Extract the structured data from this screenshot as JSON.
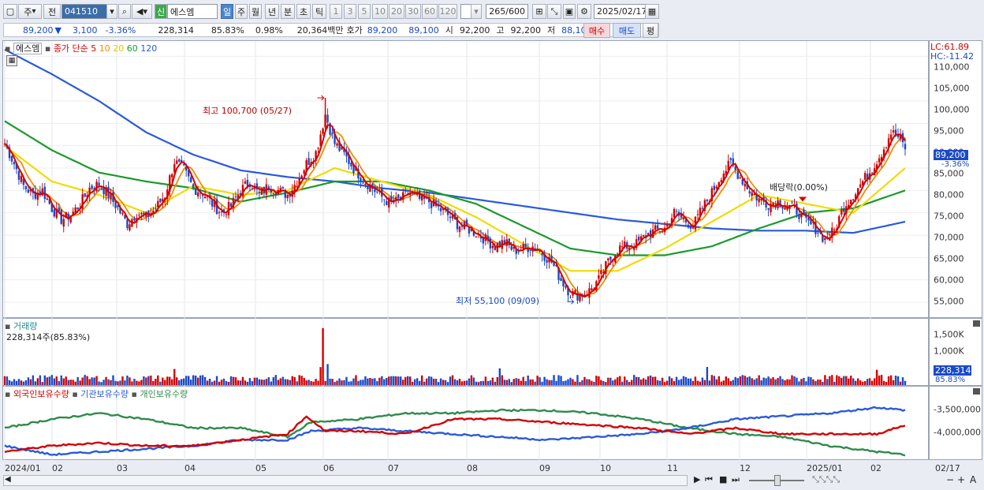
{
  "toolbar": {
    "type_label": "주",
    "prev_label": "전",
    "code": "041510",
    "badge": "신",
    "name": "에스엠",
    "periods": [
      "일",
      "주",
      "월",
      "년",
      "분",
      "초",
      "틱"
    ],
    "active_period": "일",
    "intervals": [
      "1",
      "3",
      "5",
      "10",
      "20",
      "30",
      "60",
      "120"
    ],
    "count": "265",
    "count_total": "/600",
    "date": "2025/02/17"
  },
  "quote": {
    "price": "89,200",
    "direction": "▼",
    "change": "3,100",
    "change_pct": "-3.36%",
    "volume": "228,314",
    "volume_ratio": "85.83%",
    "turnover_pct": "0.98%",
    "amount": "20,364백만",
    "bid_label": "호가",
    "ask": "89,200",
    "bid": "89,100",
    "open_label": "시",
    "open": "92,200",
    "high_label": "고",
    "high": "92,200",
    "low_label": "저",
    "low": "88,100",
    "buy_label": "매수",
    "sell_label": "매도",
    "avg_label": "평"
  },
  "price_panel": {
    "name": "에스엠",
    "ma_label": "종가 단순",
    "ma_periods": [
      "5",
      "10",
      "20",
      "60",
      "120"
    ],
    "ma_colors": [
      "#d40000",
      "#f08c00",
      "#f0dc00",
      "#1a9a2a",
      "#2a5ad8"
    ],
    "lc": "LC:61.89",
    "hc": "HC:-11.42",
    "high_annotation": "최고 100,700 (05/27)",
    "low_annotation": "최저 55,100 (09/09)",
    "dividend_annotation": "배당락(0.00%)",
    "current_price": "89,200",
    "current_pct": "-3.36%",
    "y_ticks": [
      "110,000",
      "105,000",
      "100,000",
      "95,000",
      "90,000",
      "85,000",
      "80,000",
      "75,000",
      "70,000",
      "65,000",
      "60,000",
      "55,000"
    ]
  },
  "volume_panel": {
    "title": "거래량",
    "info": "228,314주(85.83%)",
    "y_ticks": [
      "1,500K",
      "1,000K",
      "500,000"
    ],
    "current": "228,314",
    "current_pct": "85.83%"
  },
  "holdings_panel": {
    "legend": [
      "외국인보유수량",
      "기관보유수량",
      "개인보유수량"
    ],
    "colors": [
      "#d40000",
      "#2a5ad8",
      "#2e8b4a"
    ],
    "y_ticks": [
      "-3,500,000",
      "-4,000,000"
    ]
  },
  "x_axis": {
    "labels": [
      "2024/01",
      "02",
      "03",
      "04",
      "05",
      "06",
      "07",
      "08",
      "09",
      "10",
      "11",
      "12",
      "2025/01",
      "02"
    ],
    "end_label": "02/17"
  },
  "chart_data": {
    "type": "candlestick",
    "x_start": "2024/01",
    "x_end": "2025/02/17",
    "high": {
      "date": "05/27",
      "value": 100700
    },
    "low": {
      "date": "09/09",
      "value": 55100
    },
    "last_close": 89200,
    "ylim": [
      52000,
      112000
    ],
    "close_path": [
      [
        0,
        90500
      ],
      [
        4,
        86000
      ],
      [
        8,
        81000
      ],
      [
        12,
        79000
      ],
      [
        16,
        80000
      ],
      [
        20,
        76000
      ],
      [
        24,
        73500
      ],
      [
        28,
        74500
      ],
      [
        32,
        77000
      ],
      [
        36,
        80500
      ],
      [
        40,
        81500
      ],
      [
        44,
        79000
      ],
      [
        48,
        76000
      ],
      [
        52,
        72500
      ],
      [
        56,
        75000
      ],
      [
        60,
        74000
      ],
      [
        64,
        76000
      ],
      [
        68,
        79000
      ],
      [
        72,
        86500
      ],
      [
        76,
        84500
      ],
      [
        80,
        80500
      ],
      [
        84,
        79500
      ],
      [
        88,
        77000
      ],
      [
        92,
        75000
      ],
      [
        96,
        76500
      ],
      [
        100,
        80000
      ],
      [
        104,
        82000
      ],
      [
        108,
        79000
      ],
      [
        112,
        81000
      ],
      [
        116,
        80000
      ],
      [
        120,
        79000
      ],
      [
        124,
        82000
      ],
      [
        128,
        86000
      ],
      [
        132,
        88500
      ],
      [
        136,
        97000
      ],
      [
        140,
        90500
      ],
      [
        144,
        88000
      ],
      [
        148,
        85000
      ],
      [
        152,
        82500
      ],
      [
        156,
        80500
      ],
      [
        160,
        78500
      ],
      [
        164,
        77000
      ],
      [
        168,
        78000
      ],
      [
        172,
        79500
      ],
      [
        176,
        78000
      ],
      [
        180,
        77500
      ],
      [
        184,
        76000
      ],
      [
        188,
        74500
      ],
      [
        192,
        72500
      ],
      [
        196,
        71500
      ],
      [
        200,
        70500
      ],
      [
        204,
        69000
      ],
      [
        208,
        67500
      ],
      [
        212,
        68500
      ],
      [
        216,
        66500
      ],
      [
        220,
        67000
      ],
      [
        224,
        67500
      ],
      [
        228,
        66000
      ],
      [
        232,
        64000
      ],
      [
        236,
        60000
      ],
      [
        240,
        57000
      ],
      [
        244,
        56500
      ],
      [
        248,
        57500
      ],
      [
        252,
        60000
      ],
      [
        256,
        64000
      ],
      [
        260,
        67000
      ],
      [
        264,
        67500
      ],
      [
        268,
        68000
      ],
      [
        272,
        70000
      ],
      [
        276,
        71000
      ],
      [
        280,
        71500
      ],
      [
        284,
        75000
      ],
      [
        288,
        73500
      ],
      [
        292,
        72000
      ],
      [
        296,
        76000
      ],
      [
        300,
        79500
      ],
      [
        304,
        83500
      ],
      [
        308,
        86000
      ],
      [
        312,
        83000
      ],
      [
        316,
        80000
      ],
      [
        320,
        78000
      ],
      [
        324,
        77000
      ],
      [
        328,
        77500
      ],
      [
        332,
        76500
      ],
      [
        336,
        75500
      ],
      [
        340,
        73000
      ],
      [
        344,
        71500
      ],
      [
        348,
        69000
      ],
      [
        352,
        71000
      ],
      [
        356,
        76500
      ],
      [
        360,
        79000
      ],
      [
        364,
        82000
      ],
      [
        368,
        85000
      ],
      [
        372,
        88500
      ],
      [
        376,
        93000
      ],
      [
        380,
        91500
      ],
      [
        382,
        89200
      ]
    ],
    "ma_path": {
      "ma20": [
        [
          0,
          90000
        ],
        [
          20,
          82000
        ],
        [
          40,
          79000
        ],
        [
          60,
          75000
        ],
        [
          80,
          81000
        ],
        [
          100,
          79000
        ],
        [
          120,
          80000
        ],
        [
          140,
          85000
        ],
        [
          160,
          82000
        ],
        [
          180,
          79000
        ],
        [
          200,
          74000
        ],
        [
          220,
          68000
        ],
        [
          240,
          62000
        ],
        [
          260,
          62000
        ],
        [
          280,
          67000
        ],
        [
          300,
          73000
        ],
        [
          320,
          79000
        ],
        [
          340,
          77000
        ],
        [
          360,
          75000
        ],
        [
          382,
          85000
        ]
      ],
      "ma60": [
        [
          0,
          95500
        ],
        [
          20,
          89000
        ],
        [
          40,
          84000
        ],
        [
          60,
          82000
        ],
        [
          80,
          80500
        ],
        [
          100,
          77500
        ],
        [
          120,
          79500
        ],
        [
          140,
          82000
        ],
        [
          160,
          82000
        ],
        [
          180,
          80000
        ],
        [
          200,
          77000
        ],
        [
          220,
          72000
        ],
        [
          240,
          67000
        ],
        [
          260,
          65500
        ],
        [
          280,
          65500
        ],
        [
          300,
          67500
        ],
        [
          320,
          71500
        ],
        [
          340,
          75000
        ],
        [
          360,
          76000
        ],
        [
          382,
          80000
        ]
      ],
      "ma120": [
        [
          0,
          111500
        ],
        [
          20,
          106000
        ],
        [
          40,
          100000
        ],
        [
          60,
          93000
        ],
        [
          80,
          88000
        ],
        [
          100,
          84500
        ],
        [
          120,
          83000
        ],
        [
          140,
          82000
        ],
        [
          160,
          80500
        ],
        [
          180,
          79500
        ],
        [
          200,
          78000
        ],
        [
          220,
          76500
        ],
        [
          240,
          75000
        ],
        [
          260,
          73500
        ],
        [
          280,
          72500
        ],
        [
          300,
          71500
        ],
        [
          320,
          71000
        ],
        [
          340,
          71000
        ],
        [
          360,
          70500
        ],
        [
          382,
          73000
        ]
      ]
    },
    "holdings": {
      "foreign": [
        [
          0,
          -4250000
        ],
        [
          20,
          -4150000
        ],
        [
          40,
          -4100000
        ],
        [
          60,
          -4150000
        ],
        [
          80,
          -4150000
        ],
        [
          100,
          -4050000
        ],
        [
          120,
          -3950000
        ],
        [
          128,
          -3650000
        ],
        [
          136,
          -3900000
        ],
        [
          150,
          -3900000
        ],
        [
          170,
          -3950000
        ],
        [
          190,
          -3700000
        ],
        [
          210,
          -3700000
        ],
        [
          230,
          -3750000
        ],
        [
          250,
          -3800000
        ],
        [
          270,
          -3850000
        ],
        [
          290,
          -3950000
        ],
        [
          310,
          -3850000
        ],
        [
          330,
          -3950000
        ],
        [
          350,
          -3950000
        ],
        [
          370,
          -3950000
        ],
        [
          382,
          -3800000
        ]
      ],
      "institution": [
        [
          0,
          -4150000
        ],
        [
          20,
          -4300000
        ],
        [
          40,
          -4250000
        ],
        [
          60,
          -4200000
        ],
        [
          80,
          -4150000
        ],
        [
          100,
          -4050000
        ],
        [
          120,
          -4050000
        ],
        [
          130,
          -3900000
        ],
        [
          150,
          -3850000
        ],
        [
          170,
          -3900000
        ],
        [
          190,
          -3950000
        ],
        [
          210,
          -4000000
        ],
        [
          230,
          -4050000
        ],
        [
          250,
          -4000000
        ],
        [
          270,
          -3950000
        ],
        [
          290,
          -3850000
        ],
        [
          310,
          -3700000
        ],
        [
          330,
          -3650000
        ],
        [
          350,
          -3600000
        ],
        [
          370,
          -3500000
        ],
        [
          382,
          -3550000
        ]
      ],
      "individual": [
        [
          0,
          -3850000
        ],
        [
          20,
          -3700000
        ],
        [
          40,
          -3600000
        ],
        [
          60,
          -3700000
        ],
        [
          80,
          -3850000
        ],
        [
          100,
          -3850000
        ],
        [
          120,
          -4000000
        ],
        [
          130,
          -3750000
        ],
        [
          150,
          -3700000
        ],
        [
          170,
          -3600000
        ],
        [
          190,
          -3600000
        ],
        [
          210,
          -3550000
        ],
        [
          230,
          -3550000
        ],
        [
          250,
          -3600000
        ],
        [
          270,
          -3700000
        ],
        [
          290,
          -3850000
        ],
        [
          310,
          -3950000
        ],
        [
          330,
          -4000000
        ],
        [
          350,
          -4150000
        ],
        [
          370,
          -4250000
        ],
        [
          382,
          -4300000
        ]
      ]
    }
  }
}
